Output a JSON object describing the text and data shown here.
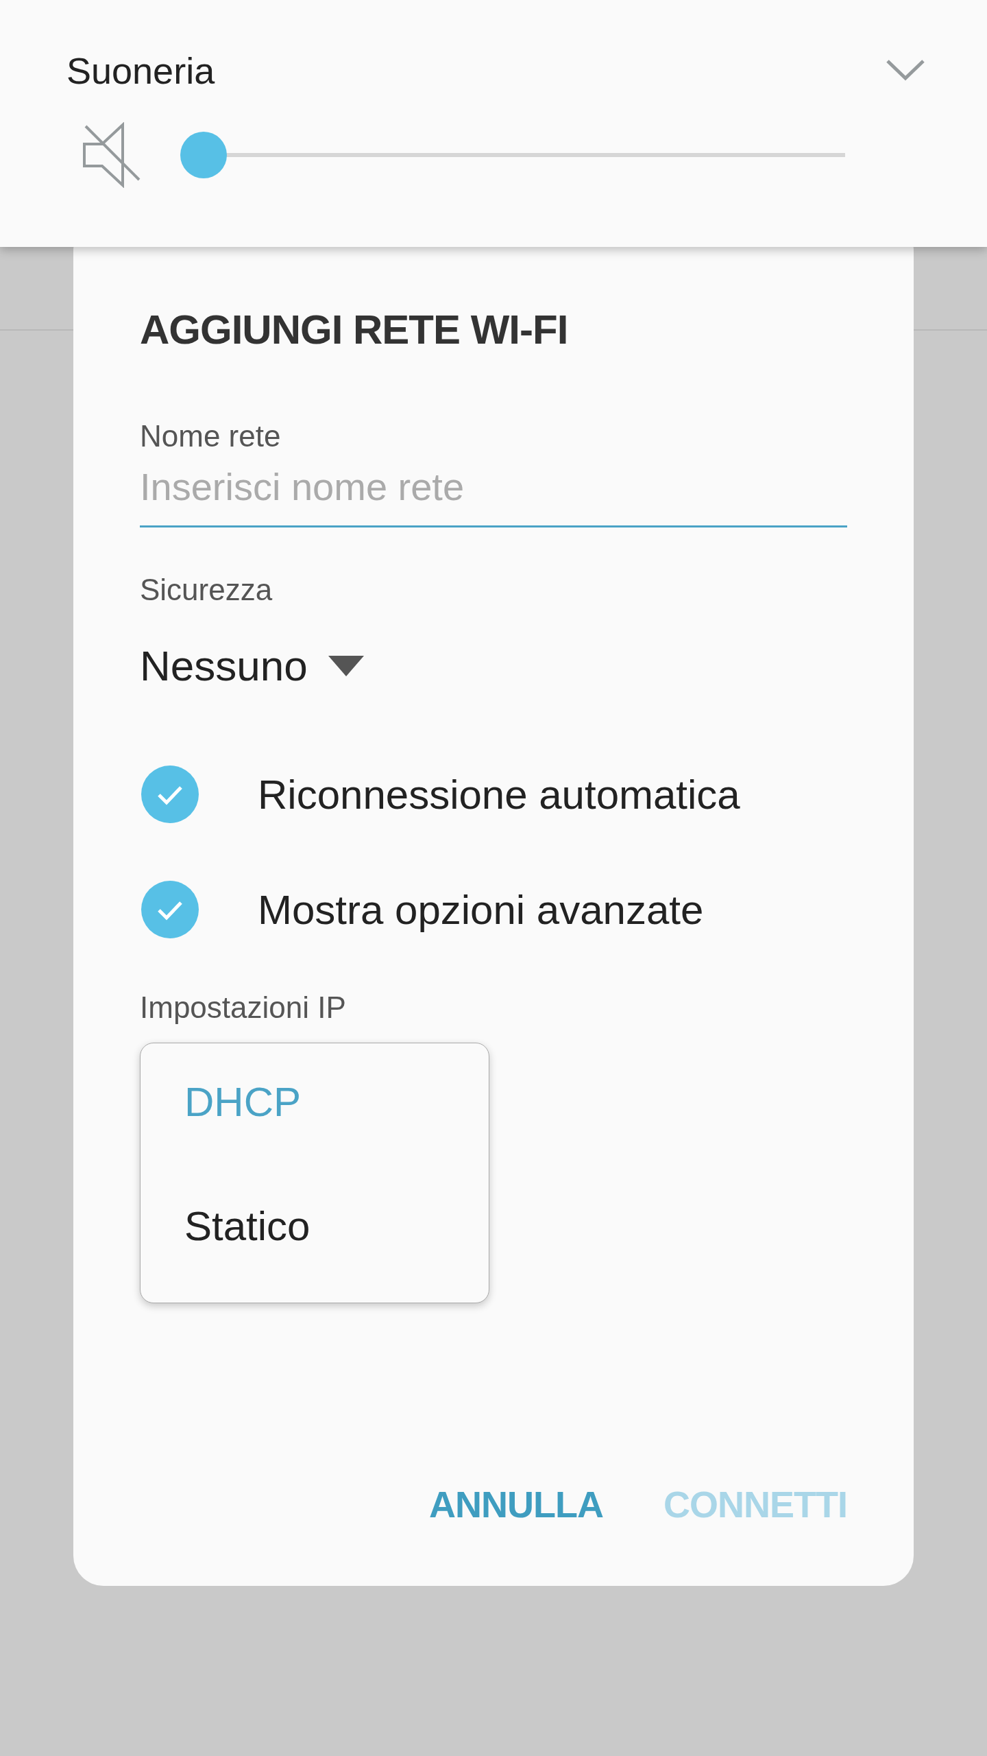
{
  "volume_panel": {
    "title": "Suoneria",
    "muted": true,
    "level": 0
  },
  "dialog": {
    "title": "AGGIUNGI RETE WI-FI",
    "network_name": {
      "label": "Nome rete",
      "placeholder": "Inserisci nome rete"
    },
    "security": {
      "label": "Sicurezza",
      "value": "Nessuno"
    },
    "checkboxes": [
      {
        "label": "Riconnessione automatica",
        "checked": true
      },
      {
        "label": "Mostra opzioni avanzate",
        "checked": true
      }
    ],
    "ip_settings": {
      "label": "Impostazioni IP",
      "options": [
        {
          "label": "DHCP",
          "selected": true
        },
        {
          "label": "Statico",
          "selected": false
        }
      ]
    },
    "buttons": [
      {
        "label": "ANNULLA",
        "disabled": false
      },
      {
        "label": "CONNETTI",
        "disabled": true
      }
    ]
  }
}
